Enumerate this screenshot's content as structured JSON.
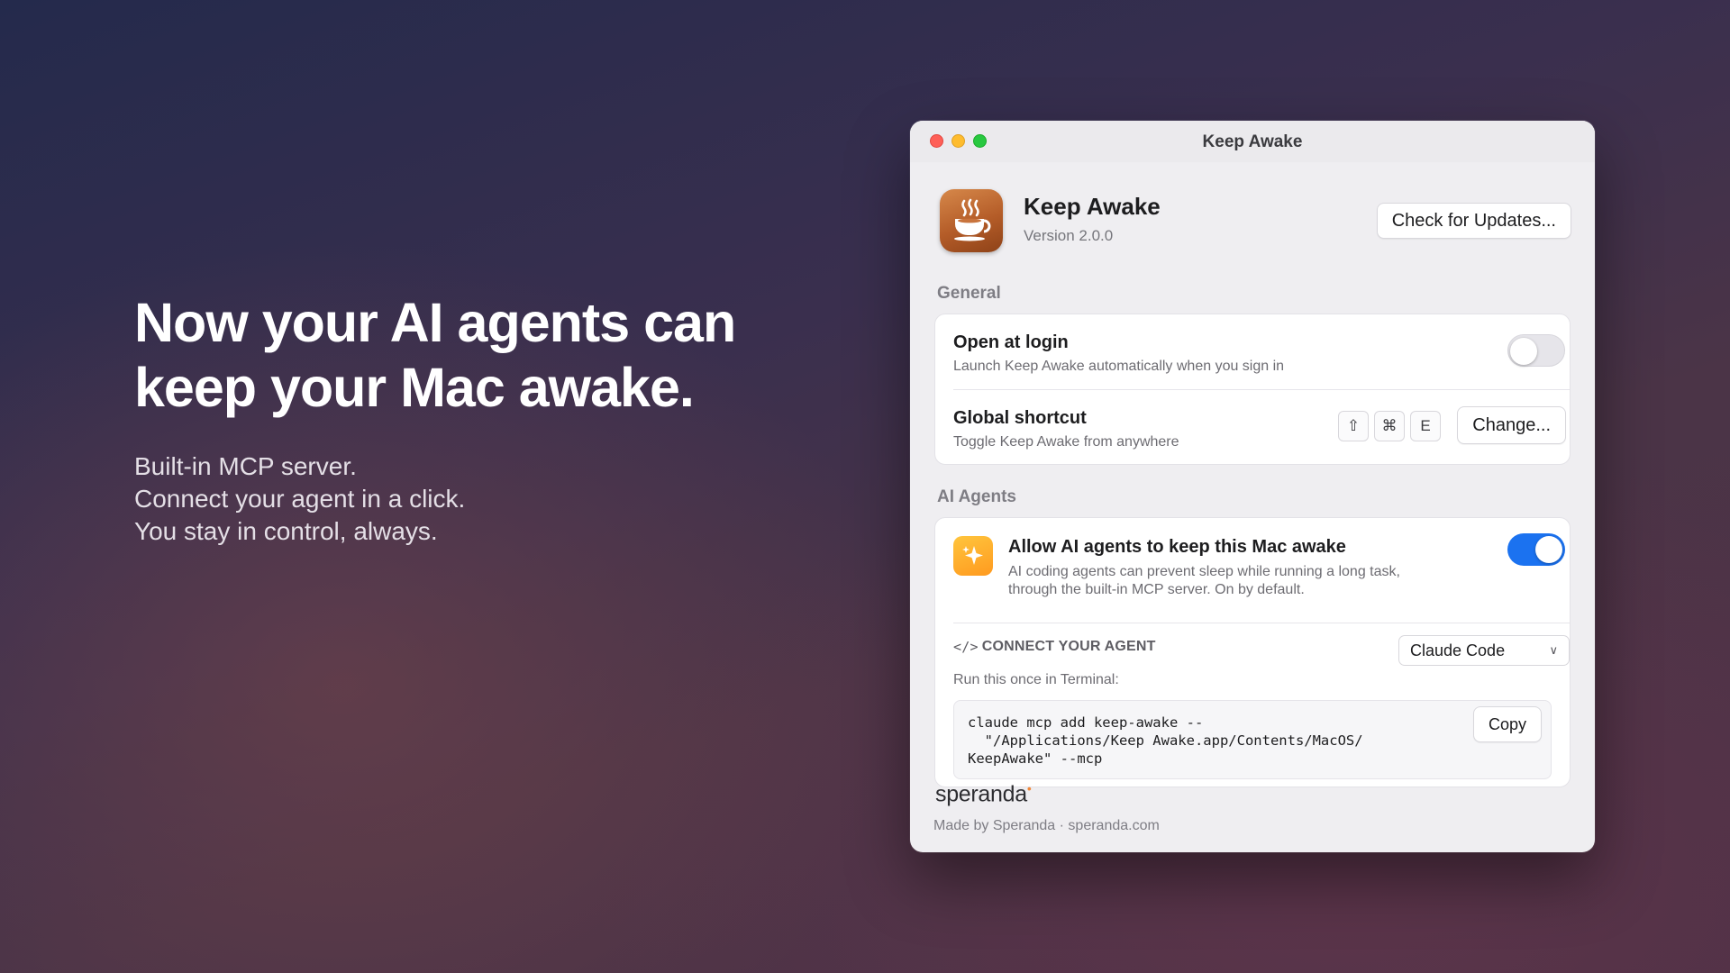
{
  "hero": {
    "title_line1": "Now your AI agents can",
    "title_line2": "keep your Mac awake.",
    "sub_line1": "Built-in MCP server.",
    "sub_line2": "Connect your agent in a click.",
    "sub_line3": "You stay in control, always."
  },
  "window": {
    "title": "Keep Awake"
  },
  "app": {
    "name": "Keep Awake",
    "version": "Version 2.0.0",
    "icon": "coffee-cup-icon",
    "check_updates_label": "Check for Updates..."
  },
  "general": {
    "label": "General",
    "open_at_login": {
      "title": "Open at login",
      "subtitle": "Launch Keep Awake automatically when you sign in",
      "enabled": false
    },
    "global_shortcut": {
      "title": "Global shortcut",
      "subtitle": "Toggle Keep Awake from anywhere",
      "keys": [
        "⇧",
        "⌘",
        "E"
      ],
      "change_label": "Change..."
    }
  },
  "ai_agents": {
    "label": "AI Agents",
    "allow": {
      "title": "Allow AI agents to keep this Mac awake",
      "subtitle_line1": "AI coding agents can prevent sleep while running a long task,",
      "subtitle_line2": "through the built-in MCP server. On by default.",
      "enabled": true,
      "icon": "sparkle-icon"
    },
    "connect": {
      "label": "CONNECT YOUR AGENT",
      "code_icon": "</>",
      "selected_agent": "Claude Code",
      "run_label": "Run this once in Terminal:",
      "command_line1": "claude mcp add keep-awake --",
      "command_line2": "  \"/Applications/Keep Awake.app/Contents/MacOS/",
      "command_line3": "KeepAwake\" --mcp",
      "copy_label": "Copy"
    }
  },
  "footer": {
    "brand": "speranda",
    "made_by": "Made by Speranda · speranda.com"
  },
  "colors": {
    "accent_blue": "#1b72f0",
    "icon_orange": "#b45c28",
    "sparkle_yellow": "#ffb02e"
  }
}
